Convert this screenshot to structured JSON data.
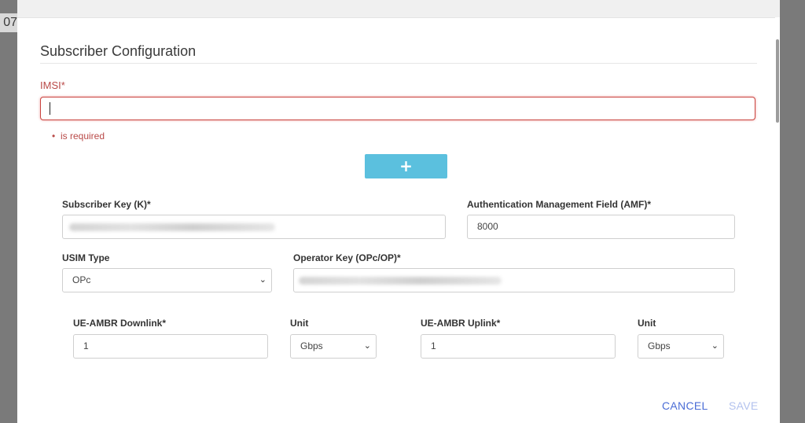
{
  "background": {
    "partial_text": "07"
  },
  "dialog": {
    "title": "Subscriber Configuration",
    "imsi": {
      "label": "IMSI*",
      "value": "",
      "error": "is required"
    },
    "add_button_label": "+",
    "subscriber_key": {
      "label": "Subscriber Key (K)*",
      "value_obscured": true
    },
    "amf": {
      "label": "Authentication Management Field (AMF)*",
      "value": "8000"
    },
    "usim_type": {
      "label": "USIM Type",
      "selected": "OPc"
    },
    "operator_key": {
      "label": "Operator Key (OPc/OP)*",
      "value_obscured": true
    },
    "ue_ambr_downlink": {
      "label": "UE-AMBR Downlink*",
      "value": "1",
      "unit_label": "Unit",
      "unit_selected": "Gbps"
    },
    "ue_ambr_uplink": {
      "label": "UE-AMBR Uplink*",
      "value": "1",
      "unit_label": "Unit",
      "unit_selected": "Gbps"
    },
    "footer": {
      "cancel_label": "CANCEL",
      "save_label": "SAVE"
    }
  },
  "colors": {
    "error": "#b94a48",
    "add_button": "#5bc0de",
    "cancel": "#4b6dd6",
    "save_disabled": "#b3c2ee"
  },
  "icons": {
    "select_arrow": "chevron-down-icon"
  }
}
